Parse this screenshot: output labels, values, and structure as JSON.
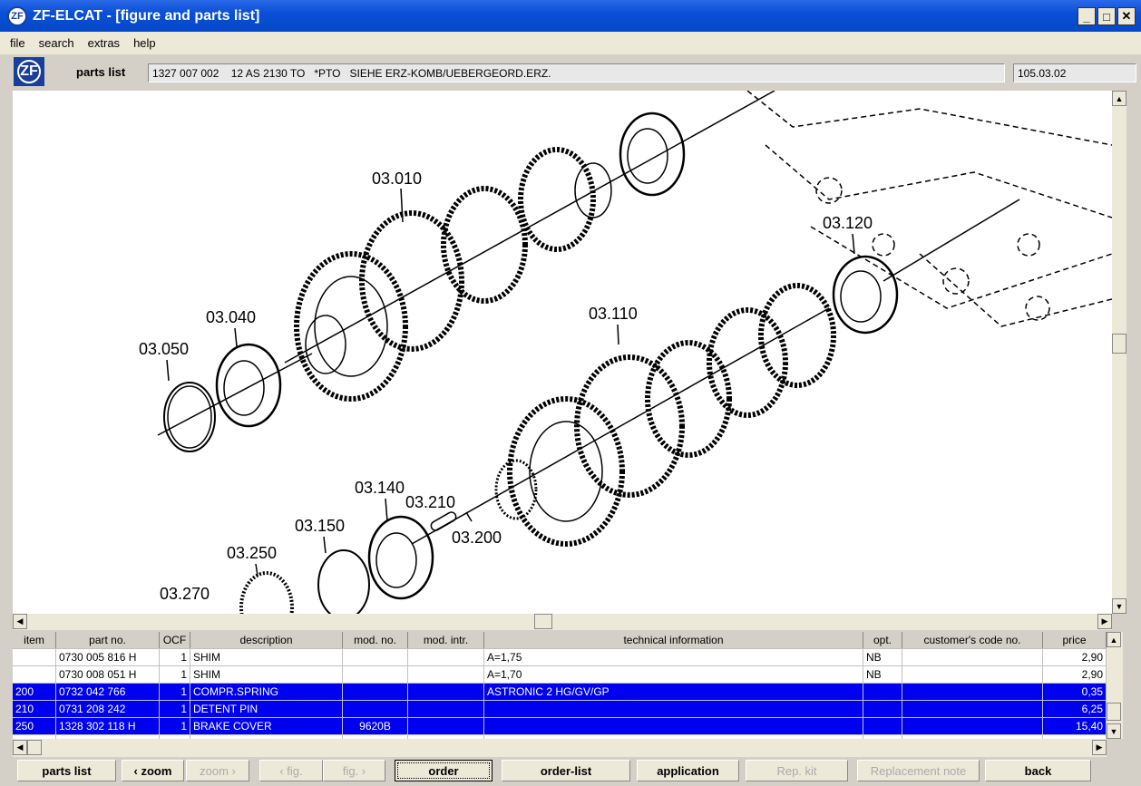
{
  "window": {
    "title": "ZF-ELCAT - [figure and parts list]",
    "logo": "ZF"
  },
  "menu": [
    "file",
    "search",
    "extras",
    "help"
  ],
  "header": {
    "label": "parts list",
    "description": "1327 007 002    12 AS 2130 TO   *PTO   SIEHE ERZ-KOMB/UEBERGEORD.ERZ.",
    "figure_no": "105.03.02"
  },
  "drawing": {
    "callouts": [
      "03.010",
      "03.040",
      "03.050",
      "03.120",
      "03.110",
      "03.140",
      "03.210",
      "03.200",
      "03.150",
      "03.250",
      "03.270"
    ]
  },
  "table": {
    "columns": [
      "item",
      "part no.",
      "OCF",
      "description",
      "mod. no.",
      "mod. intr.",
      "technical information",
      "opt.",
      "customer's code no.",
      "price"
    ],
    "rows": [
      {
        "item": "",
        "part": "0730 005 816  H",
        "ocf": "1",
        "desc": "SHIM",
        "mod": "",
        "intr": "",
        "tech": "A=1,75",
        "opt": "NB",
        "cust": "",
        "price": "2,90",
        "selected": false
      },
      {
        "item": "",
        "part": "0730 008 051  H",
        "ocf": "1",
        "desc": "SHIM",
        "mod": "",
        "intr": "",
        "tech": "A=1,70",
        "opt": "NB",
        "cust": "",
        "price": "2,90",
        "selected": false
      },
      {
        "item": "200",
        "part": "0732 042 766",
        "ocf": "1",
        "desc": "COMPR.SPRING",
        "mod": "",
        "intr": "",
        "tech": "ASTRONIC 2 HG/GV/GP",
        "opt": "",
        "cust": "",
        "price": "0,35",
        "selected": true
      },
      {
        "item": "210",
        "part": "0731 208 242",
        "ocf": "1",
        "desc": "DETENT PIN",
        "mod": "",
        "intr": "",
        "tech": "",
        "opt": "",
        "cust": "",
        "price": "6,25",
        "selected": true
      },
      {
        "item": "250",
        "part": "1328 302 118  H",
        "ocf": "1",
        "desc": "BRAKE COVER",
        "mod": "9620B",
        "intr": "",
        "tech": "",
        "opt": "",
        "cust": "",
        "price": "15,40",
        "selected": true
      }
    ]
  },
  "buttons": {
    "parts_list": "parts list",
    "zoom_out": "‹ zoom",
    "zoom_in": "zoom ›",
    "fig_prev": "‹ fig.",
    "fig_next": "fig. ›",
    "order": "order",
    "order_list": "order-list",
    "application": "application",
    "rep_kit": "Rep. kit",
    "replacement_note": "Replacement note",
    "back": "back"
  },
  "colors": {
    "title_bar": "#0a4fd6",
    "selection": "#0000f0",
    "brand": "#1a3f9a"
  }
}
